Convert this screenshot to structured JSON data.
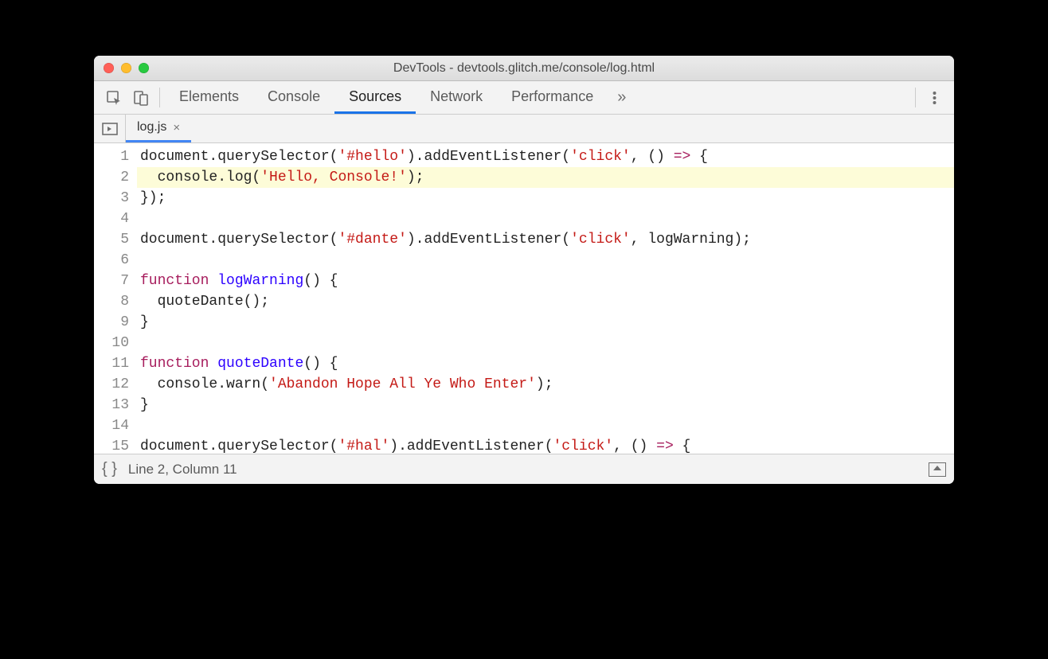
{
  "window": {
    "title": "DevTools - devtools.glitch.me/console/log.html"
  },
  "tabs": {
    "items": [
      "Elements",
      "Console",
      "Sources",
      "Network",
      "Performance"
    ],
    "active_index": 2,
    "overflow_glyph": "»"
  },
  "file_tab": {
    "name": "log.js",
    "close_glyph": "×"
  },
  "code": {
    "highlighted_line": 2,
    "lines": [
      [
        {
          "t": "document.querySelector("
        },
        {
          "t": "'#hello'",
          "c": "str"
        },
        {
          "t": ").addEventListener("
        },
        {
          "t": "'click'",
          "c": "str"
        },
        {
          "t": ", () "
        },
        {
          "t": "=>",
          "c": "kw"
        },
        {
          "t": " {"
        }
      ],
      [
        {
          "t": "  console.log("
        },
        {
          "t": "'Hello, Console!'",
          "c": "str"
        },
        {
          "t": ");"
        }
      ],
      [
        {
          "t": "});"
        }
      ],
      [
        {
          "t": ""
        }
      ],
      [
        {
          "t": "document.querySelector("
        },
        {
          "t": "'#dante'",
          "c": "str"
        },
        {
          "t": ").addEventListener("
        },
        {
          "t": "'click'",
          "c": "str"
        },
        {
          "t": ", logWarning);"
        }
      ],
      [
        {
          "t": ""
        }
      ],
      [
        {
          "t": "function",
          "c": "kw"
        },
        {
          "t": " "
        },
        {
          "t": "logWarning",
          "c": "fn"
        },
        {
          "t": "() {"
        }
      ],
      [
        {
          "t": "  quoteDante();"
        }
      ],
      [
        {
          "t": "}"
        }
      ],
      [
        {
          "t": ""
        }
      ],
      [
        {
          "t": "function",
          "c": "kw"
        },
        {
          "t": " "
        },
        {
          "t": "quoteDante",
          "c": "fn"
        },
        {
          "t": "() {"
        }
      ],
      [
        {
          "t": "  console.warn("
        },
        {
          "t": "'Abandon Hope All Ye Who Enter'",
          "c": "str"
        },
        {
          "t": ");"
        }
      ],
      [
        {
          "t": "}"
        }
      ],
      [
        {
          "t": ""
        }
      ],
      [
        {
          "t": "document.querySelector("
        },
        {
          "t": "'#hal'",
          "c": "str"
        },
        {
          "t": ").addEventListener("
        },
        {
          "t": "'click'",
          "c": "str"
        },
        {
          "t": ", () "
        },
        {
          "t": "=>",
          "c": "kw"
        },
        {
          "t": " {"
        }
      ]
    ]
  },
  "status": {
    "position": "Line 2, Column 11",
    "braces": "{ }"
  }
}
